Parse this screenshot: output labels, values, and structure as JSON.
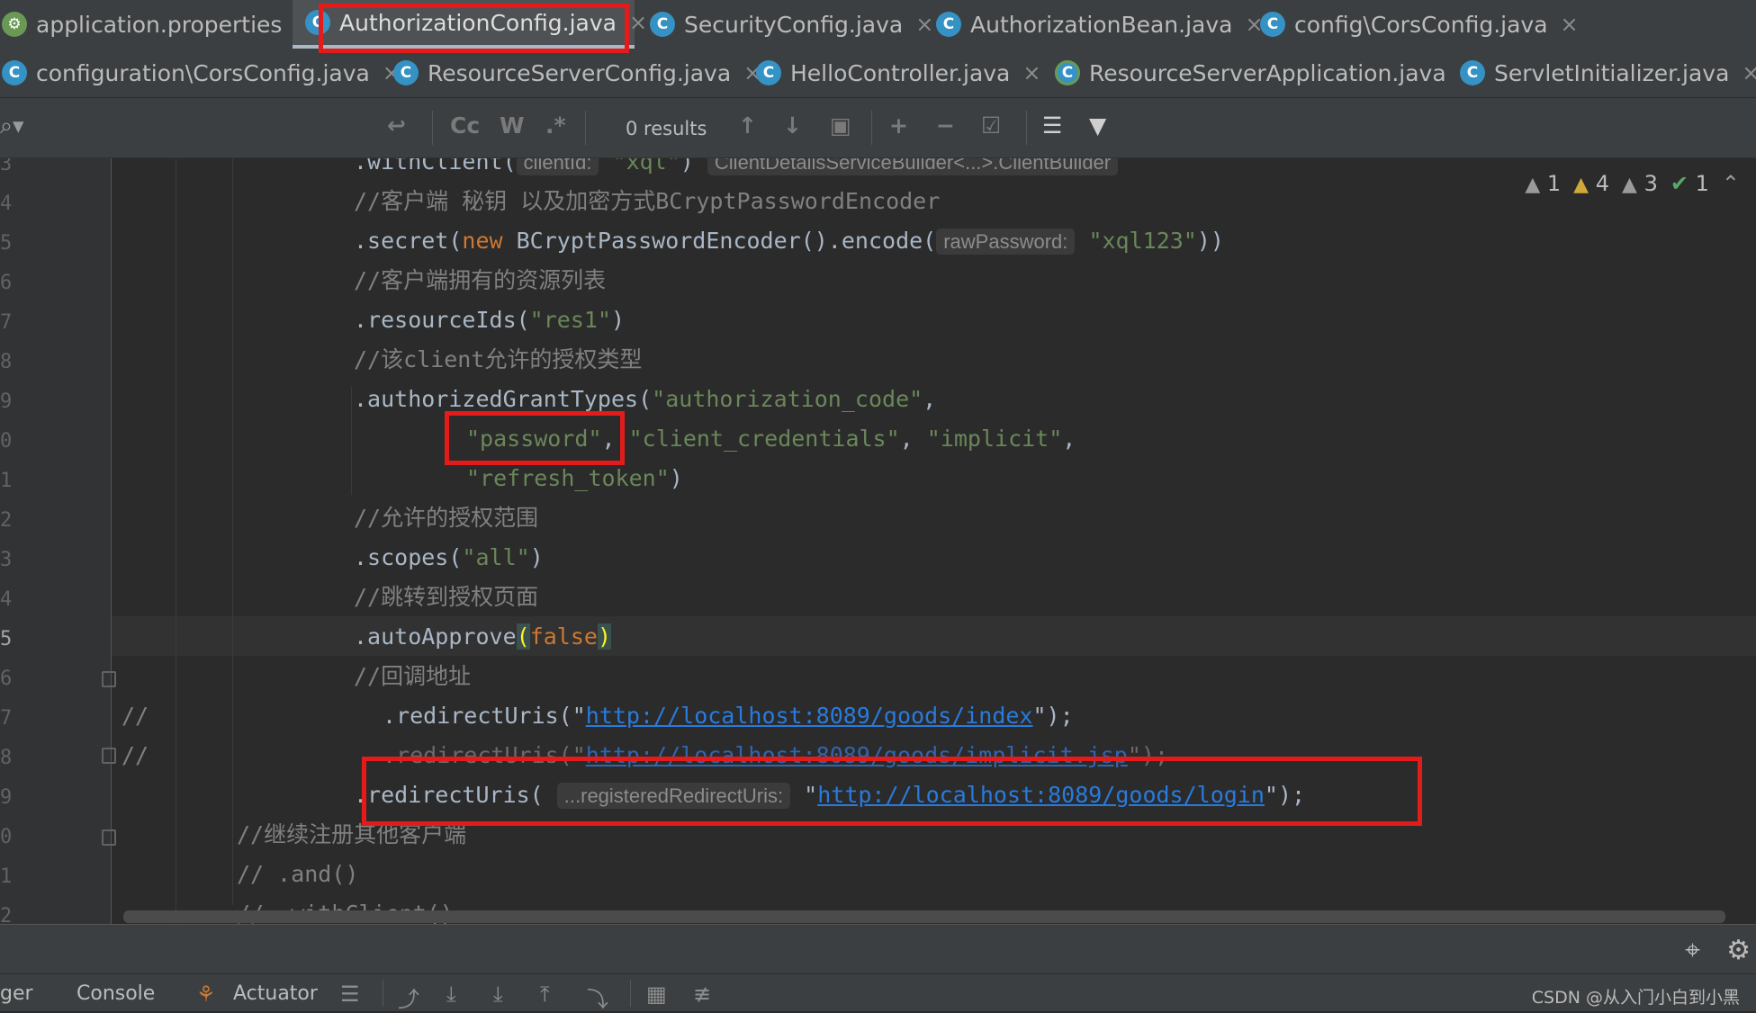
{
  "tabs_row1": [
    {
      "label": "application.properties",
      "icon": "spring-properties-icon",
      "active": false
    },
    {
      "label": "AuthorizationConfig.java",
      "icon": "class-icon",
      "active": true
    },
    {
      "label": "SecurityConfig.java",
      "icon": "class-icon",
      "active": false
    },
    {
      "label": "AuthorizationBean.java",
      "icon": "class-icon",
      "active": false
    },
    {
      "label": "config\\CorsConfig.java",
      "icon": "class-icon",
      "active": false
    }
  ],
  "tabs_row2": [
    {
      "label": "configuration\\CorsConfig.java",
      "icon": "class-icon"
    },
    {
      "label": "ResourceServerConfig.java",
      "icon": "class-icon"
    },
    {
      "label": "HelloController.java",
      "icon": "class-icon"
    },
    {
      "label": "ResourceServerApplication.java",
      "icon": "spring-app-icon"
    },
    {
      "label": "ServletInitializer.java",
      "icon": "class-icon"
    }
  ],
  "tab_close_glyph": "×",
  "class_icon_letter": "C",
  "findbar": {
    "results": "0 results",
    "match_case": "Cc",
    "words": "W",
    "regex": ".*"
  },
  "inspections": {
    "weak_warnings": "1",
    "warnings": "4",
    "weak_warnings_2": "3",
    "ok": "1"
  },
  "line_numbers": [
    "3",
    "4",
    "5",
    "6",
    "7",
    "8",
    "9",
    "0",
    "1",
    "2",
    "3",
    "4",
    "5",
    "6",
    "7",
    "8",
    "9",
    "0",
    "1",
    "2"
  ],
  "code": {
    "l53": {
      "prefix": ".withClient(",
      "hint": "clientId:",
      "arg": "\"xql\"",
      "suffix": ")",
      "hint2": "ClientDetailsServiceBuilder<...>.ClientBuilder"
    },
    "l54": "//客户端 秘钥 以及加密方式BCryptPasswordEncoder",
    "l55": {
      "prefix": ".secret(",
      "kw": "new",
      "mid": " BCryptPasswordEncoder().encode(",
      "hint": "rawPassword:",
      "arg": "\"xql123\"",
      "suffix": "))"
    },
    "l56": "//客户端拥有的资源列表",
    "l57": {
      "prefix": ".resourceIds(",
      "arg": "\"res1\"",
      "suffix": ")"
    },
    "l58": "//该client允许的授权类型",
    "l59": {
      "prefix": ".authorizedGrantTypes(",
      "arg": "\"authorization_code\"",
      "suffix": ","
    },
    "l60": {
      "a1": "\"password\"",
      "a2": "\"client_credentials\"",
      "a3": "\"implicit\""
    },
    "l61": {
      "arg": "\"refresh_token\"",
      "suffix": ")"
    },
    "l62": "//允许的授权范围",
    "l63": {
      "prefix": ".scopes(",
      "arg": "\"all\"",
      "suffix": ")"
    },
    "l64": "//跳转到授权页面",
    "l65": {
      "prefix": ".autoApprove",
      "open": "(",
      "kw": "false",
      "close": ")"
    },
    "l66": "//回调地址",
    "l67": {
      "comment": "//",
      "prefix": ".redirectUris(\"",
      "url": "http://localhost:8089/goods/index",
      "suffix": "\");"
    },
    "l68": {
      "comment": "//",
      "prefix": ".redirectUris(\"",
      "url": "http://localhost:8089/goods/implicit.jsp",
      "suffix": "\");"
    },
    "l69": {
      "prefix": ".redirectUris(",
      "hint": "...registeredRedirectUris:",
      "q": "\"",
      "url": "http://localhost:8089/goods/login",
      "suffix": "\");"
    },
    "l70": "//继续注册其他客户端",
    "l71": "// .and()",
    "l72": "// .withClient()"
  },
  "bottom_tools": {
    "debugger_partial": "ger",
    "console": "Console",
    "actuator": "Actuator"
  },
  "credit": "CSDN @从入门小白到小黑",
  "colors": {
    "background": "#2b2b2b",
    "string": "#6a8759",
    "keyword": "#cc7832",
    "comment": "#808080",
    "url": "#287bde",
    "annotation_box": "#e41b1b"
  }
}
